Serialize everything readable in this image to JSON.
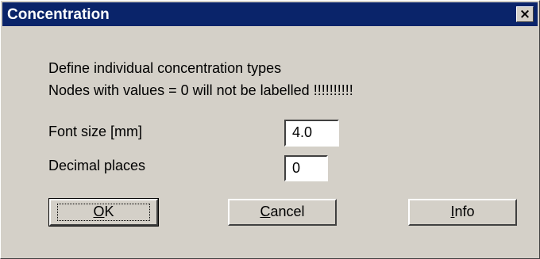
{
  "window": {
    "title": "Concentration",
    "close_glyph": "×"
  },
  "intro": {
    "line1": "Define individual concentration types",
    "line2": "Nodes with values = 0 will not be labelled !!!!!!!!!!"
  },
  "font_size": {
    "label": "Font size [mm]",
    "value": "4.0"
  },
  "decimal_places": {
    "label": "Decimal places",
    "value": "0"
  },
  "buttons": {
    "ok": {
      "mnemonic": "O",
      "rest": "K"
    },
    "cancel": {
      "mnemonic": "C",
      "rest": "ancel"
    },
    "info": {
      "mnemonic": "I",
      "rest": "nfo"
    }
  },
  "icons": {
    "close": "close-icon"
  },
  "colors": {
    "titlebar": "#0a246a",
    "face": "#d4d0c8"
  }
}
